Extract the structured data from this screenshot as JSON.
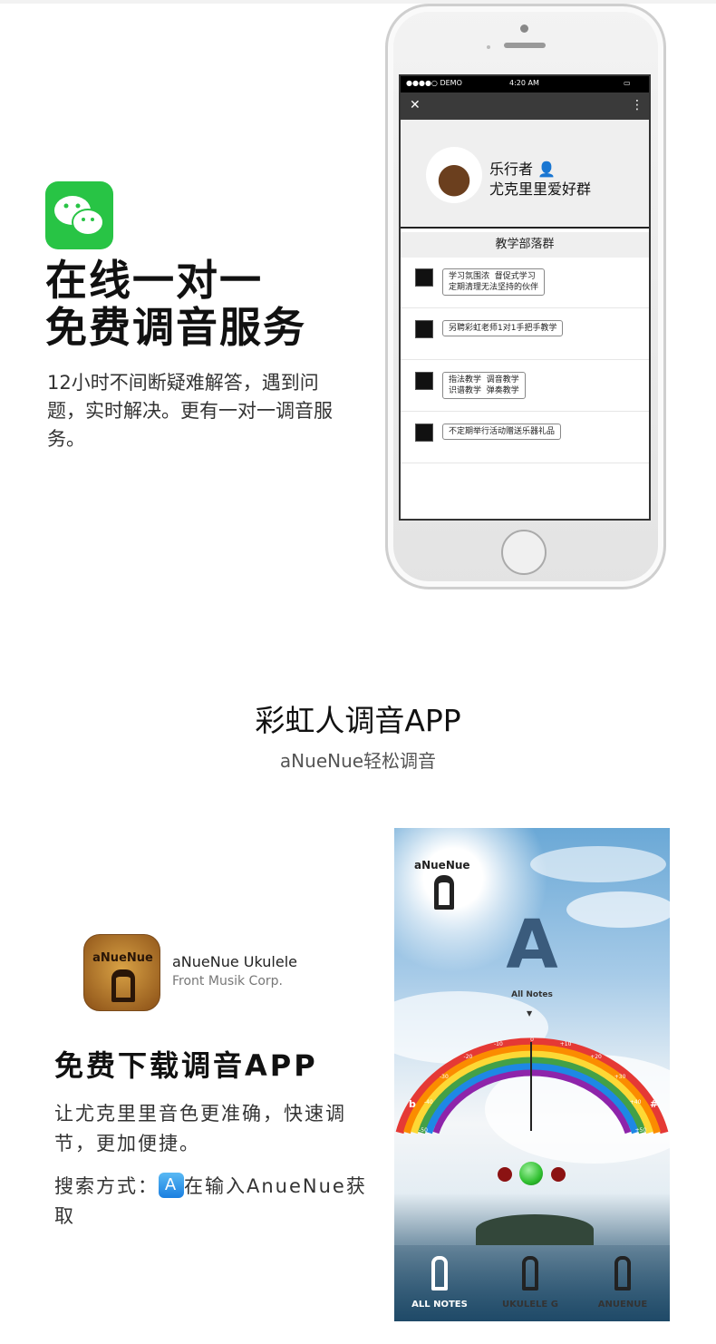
{
  "section1": {
    "headline_line1": "在线一对一",
    "headline_line2": "免费调音服务",
    "description": "12小时不间断疑难解答，遇到问题，实时解决。更有一对一调音服务。"
  },
  "phone": {
    "status": {
      "carrier": "●●●●○ DEMO",
      "time": "4:20 AM"
    },
    "nav": {
      "close": "✕",
      "more": "⋮"
    },
    "group": {
      "name_line1": "乐行者",
      "name_line2": "尤克里里爱好群"
    },
    "list_title": "教学部落群",
    "items": [
      {
        "text": "学习氛围浓  督促式学习\n定期清理无法坚持的伙伴"
      },
      {
        "text": "另聘彩虹老师1对1手把手教学"
      },
      {
        "text": "指法教学  调音教学\n识谱教学  弹奏教学"
      },
      {
        "text": "不定期举行活动赠送乐器礼品"
      }
    ]
  },
  "section2": {
    "title": "彩虹人调音APP",
    "subtitle": "aNueNue轻松调音",
    "app_icon_logo": "aNueNue",
    "app_name": "aNueNue Ukulele",
    "app_company": "Front Musik Corp.",
    "headline": "免费下载调音APP",
    "description": "让尤克里里音色更准确，快速调节，更加便捷。",
    "search_prefix": "搜索方式：",
    "search_suffix": "在输入AnueNue获取"
  },
  "tuner": {
    "logo": "aNueNue",
    "note": "A",
    "mode_label": "All Notes",
    "flat_label": "b",
    "sharp_label": "#",
    "scale_ticks": [
      "-50",
      "-40",
      "-30",
      "-20",
      "-10",
      "0",
      "+10",
      "+20",
      "+30",
      "+40",
      "+50"
    ],
    "tabs": [
      {
        "label": "ALL NOTES"
      },
      {
        "label": "UKULELE G"
      },
      {
        "label": "ANUENUE"
      }
    ]
  },
  "colors": {
    "wechat_green": "#28c445",
    "rainbow_center_green": "#2fbf2f",
    "indicator_red": "#8b1212"
  }
}
